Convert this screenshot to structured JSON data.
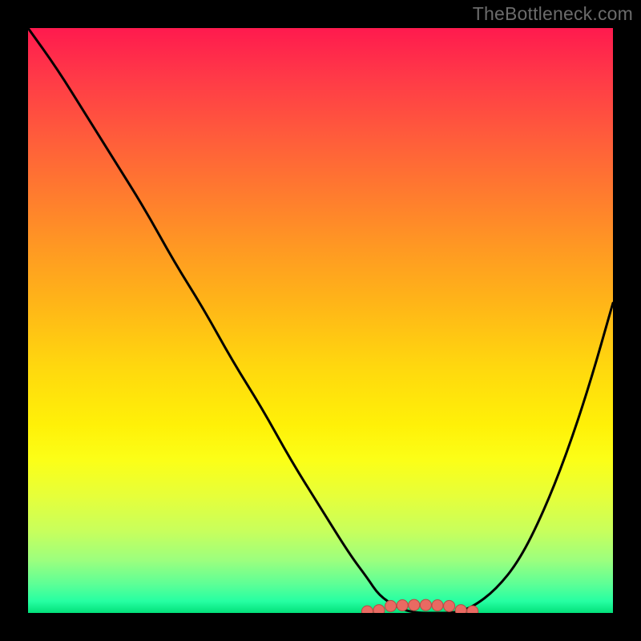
{
  "watermark": "TheBottleneck.com",
  "colors": {
    "frame": "#000000",
    "curve_stroke": "#000000",
    "dot_fill": "#e96a62",
    "dot_stroke": "#b84b44",
    "gradient_stops": [
      {
        "offset": 0.0,
        "color": "#ff1a4e"
      },
      {
        "offset": 0.08,
        "color": "#ff3848"
      },
      {
        "offset": 0.18,
        "color": "#ff5a3c"
      },
      {
        "offset": 0.28,
        "color": "#ff7a2f"
      },
      {
        "offset": 0.38,
        "color": "#ff9a22"
      },
      {
        "offset": 0.48,
        "color": "#ffb817"
      },
      {
        "offset": 0.58,
        "color": "#ffd80e"
      },
      {
        "offset": 0.68,
        "color": "#fff108"
      },
      {
        "offset": 0.74,
        "color": "#fbff18"
      },
      {
        "offset": 0.8,
        "color": "#e6ff3a"
      },
      {
        "offset": 0.86,
        "color": "#c8ff5c"
      },
      {
        "offset": 0.91,
        "color": "#9cff7e"
      },
      {
        "offset": 0.95,
        "color": "#5eff96"
      },
      {
        "offset": 0.98,
        "color": "#26ffa2"
      },
      {
        "offset": 1.0,
        "color": "#02e07a"
      }
    ]
  },
  "chart_data": {
    "type": "line",
    "title": "",
    "xlabel": "",
    "ylabel": "",
    "xlim": [
      0,
      100
    ],
    "ylim": [
      0,
      100
    ],
    "series": [
      {
        "name": "bottleneck-curve",
        "x": [
          0,
          5,
          10,
          15,
          20,
          25,
          30,
          35,
          40,
          45,
          50,
          55,
          58,
          60,
          63,
          66,
          70,
          73,
          76,
          80,
          84,
          88,
          92,
          96,
          100
        ],
        "y": [
          100,
          93,
          85,
          77,
          69,
          60,
          52,
          43,
          35,
          26,
          18,
          10,
          6,
          3,
          1,
          0,
          0,
          0,
          1,
          4,
          9,
          17,
          27,
          39,
          53
        ]
      }
    ],
    "highlight_band": {
      "name": "optimal-zone-dots",
      "x_start": 58,
      "x_end": 76,
      "y": 0
    }
  }
}
